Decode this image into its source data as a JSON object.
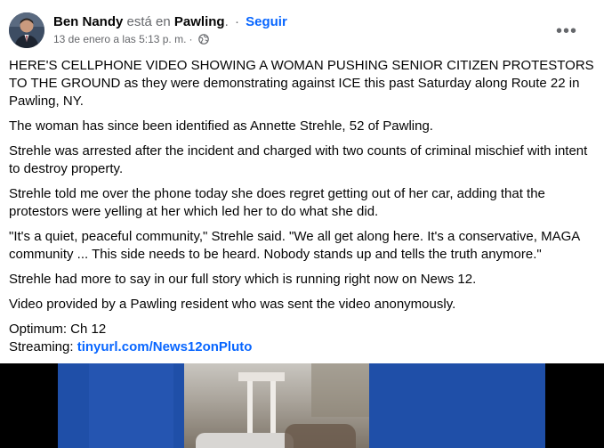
{
  "post": {
    "author": "Ben Nandy",
    "location_prefix": "está en",
    "location": "Pawling",
    "location_suffix": ".",
    "separator": "·",
    "follow_label": "Seguir",
    "timestamp": "13 de enero a las 5:13 p. m.",
    "meta_separator": "·",
    "privacy_icon": "globe-icon",
    "more_icon": "more-options-icon",
    "more_label": "•••",
    "paragraphs": [
      "HERE'S CELLPHONE VIDEO SHOWING A WOMAN PUSHING SENIOR CITIZEN PROTESTORS TO THE GROUND as they were demonstrating against ICE this past Saturday along Route 22 in Pawling, NY.",
      "The woman has since been identified as Annette Strehle, 52 of Pawling.",
      "Strehle was arrested after the incident and charged with two counts of criminal mischief with intent to destroy property.",
      "Strehle told me over the phone today she does regret getting out of her car, adding that the protestors were yelling at her which led her to do what she did.",
      "\"It's a quiet, peaceful community,\" Strehle said. \"We all get along here. It's a conservative, MAGA community ... This side needs to be heard. Nobody stands up and tells the truth anymore.\"",
      "Strehle had more to say in our full story which is running right now on News 12.",
      "Video provided by a Pawling resident who was sent the video anonymously."
    ],
    "optimum_line": "Optimum: Ch 12",
    "streaming_label": "Streaming:",
    "streaming_link": "tinyurl.com/News12onPluto"
  },
  "colors": {
    "link": "#0866ff",
    "muted": "#65676b",
    "text": "#050505",
    "media_blue": "#1f4fa8"
  }
}
